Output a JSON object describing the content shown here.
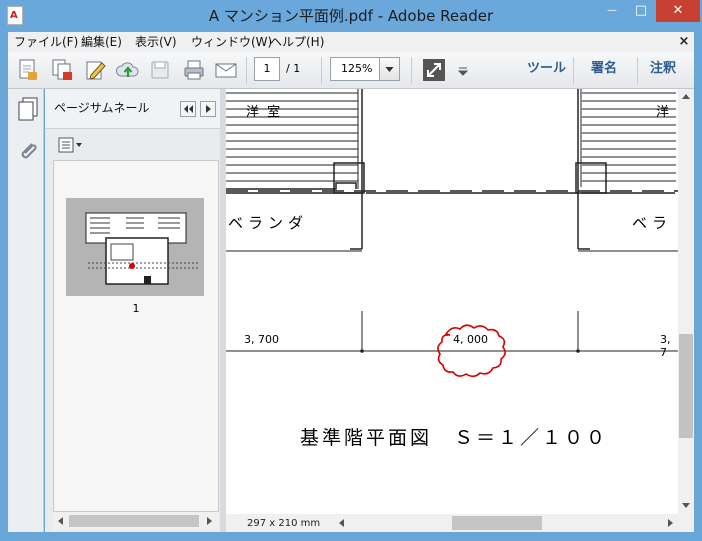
{
  "window": {
    "title": "A マンション平面例.pdf - Adobe Reader",
    "app_icon_letter": "A"
  },
  "caption_buttons": {
    "minimize": "—",
    "maximize": "□",
    "close": "✕"
  },
  "menu": {
    "items": [
      "ファイル(F)",
      "編集(E)",
      "表示(V)",
      "ウィンドウ(W)",
      "ヘルプ(H)"
    ],
    "close_glyph": "×"
  },
  "toolbar": {
    "icons": [
      "create-pdf-icon",
      "combine-icon",
      "edit-icon",
      "upload-icon",
      "save-icon",
      "print-icon",
      "email-icon"
    ],
    "page_current": "1",
    "page_total": "/ 1",
    "zoom": "125%",
    "tools_label": "ツール",
    "sign_label": "署名",
    "comment_label": "注釈"
  },
  "nav_panel": {
    "title": "ページサムネール",
    "thumbnail_label": "1"
  },
  "document": {
    "room_label_left": "洋 室",
    "room_label_right": "洋",
    "balcony_left": "ベランダ",
    "balcony_right": "ベラ",
    "dim_left": "3, 700",
    "dim_center": "4, 000",
    "dim_right": "3, 7",
    "plan_title": "基準階平面図　Ｓ＝１／１００",
    "page_size": "297 x 210 mm"
  },
  "colors": {
    "titlebar": "#6aa7da",
    "close_button": "#c84031",
    "revision_cloud": "#d80000",
    "toolbar_text": "#2b5d91"
  }
}
